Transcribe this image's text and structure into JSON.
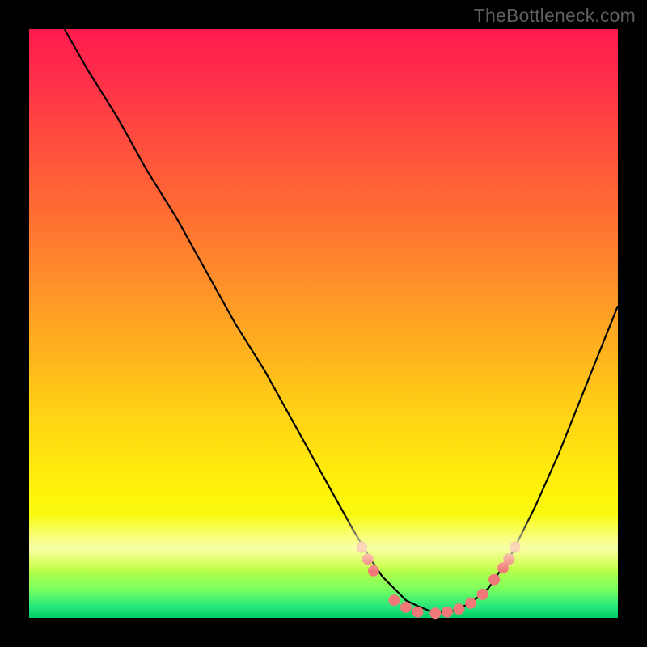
{
  "watermark_text": "TheBottleneck.com",
  "chart_data": {
    "type": "line",
    "title": "",
    "xlabel": "",
    "ylabel": "",
    "xlim": [
      0,
      100
    ],
    "ylim": [
      0,
      100
    ],
    "grid": false,
    "series": [
      {
        "name": "curve",
        "x": [
          6,
          10,
          15,
          20,
          25,
          30,
          35,
          40,
          45,
          50,
          55,
          58,
          60,
          62,
          64,
          66,
          68,
          70,
          72,
          75,
          78,
          82,
          86,
          90,
          94,
          98,
          100
        ],
        "y": [
          100,
          93,
          85,
          76,
          68,
          59,
          50,
          42,
          33,
          24,
          15,
          10,
          7,
          5,
          3,
          2,
          1.2,
          1,
          1.2,
          2.5,
          5,
          11,
          19,
          28,
          38,
          48,
          53
        ]
      }
    ],
    "markers": [
      {
        "x": 56.5,
        "y": 12.0
      },
      {
        "x": 57.5,
        "y": 10.0
      },
      {
        "x": 58.5,
        "y": 8.0
      },
      {
        "x": 62.0,
        "y": 3.0
      },
      {
        "x": 64.0,
        "y": 1.8
      },
      {
        "x": 66.0,
        "y": 1.0
      },
      {
        "x": 69.0,
        "y": 0.8
      },
      {
        "x": 71.0,
        "y": 1.0
      },
      {
        "x": 73.0,
        "y": 1.5
      },
      {
        "x": 75.0,
        "y": 2.5
      },
      {
        "x": 77.0,
        "y": 4.0
      },
      {
        "x": 79.0,
        "y": 6.5
      },
      {
        "x": 80.5,
        "y": 8.5
      },
      {
        "x": 81.5,
        "y": 10.0
      },
      {
        "x": 82.5,
        "y": 12.0
      }
    ],
    "background_gradient": {
      "top_color": "#ff1a4d",
      "bottom_color": "#00cc66"
    },
    "marker_color": "#f07878",
    "curve_color": "#000000"
  }
}
